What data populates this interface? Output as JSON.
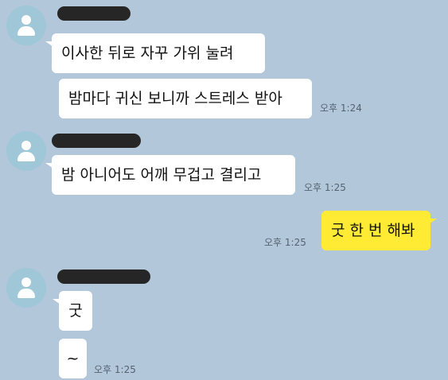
{
  "messages": {
    "m1": "이사한 뒤로 자꾸 가위 눌려",
    "m2": "밤마다 귀신 보니까 스트레스 받아",
    "m2_time": "오후 1:24",
    "m3": "밤 아니어도 어깨 무겁고 결리고",
    "m3_time": "오후 1:25",
    "m4": "굿 한 번 해봐",
    "m4_time": "오후 1:25",
    "m5": "굿",
    "m6": "~",
    "m6_time": "오후 1:25"
  },
  "colors": {
    "background": "#b2c7da",
    "incoming_bubble": "#ffffff",
    "outgoing_bubble": "#ffeb33",
    "avatar": "#9fc7d8",
    "redacted_name": "#262626"
  },
  "icons": [
    "default-profile-avatar-icon"
  ]
}
